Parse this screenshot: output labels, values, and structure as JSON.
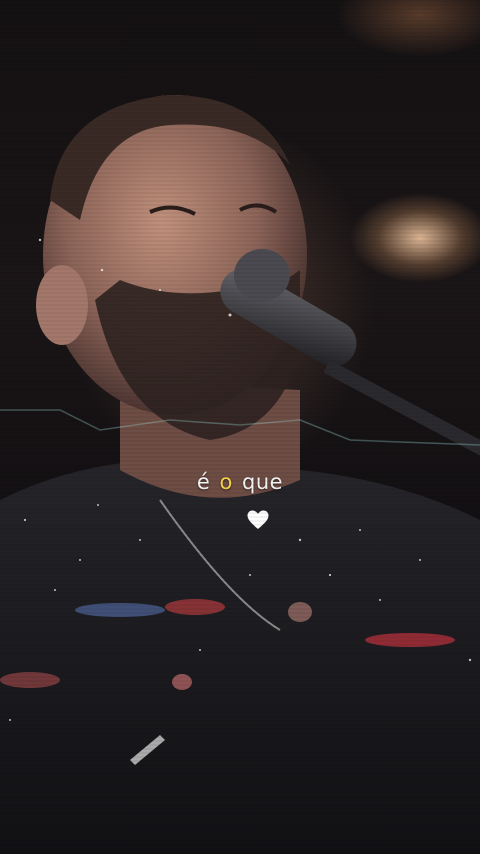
{
  "lyric": {
    "words": [
      "é",
      "o",
      "que"
    ],
    "highlight_color": "#f5d34a",
    "text_color": "#f4f4f4"
  },
  "heart_icon": "heart-icon",
  "colors": {
    "background": "#0a0a0c",
    "stage_light": "#ffd2aa",
    "shirt": "#1c1c20"
  }
}
